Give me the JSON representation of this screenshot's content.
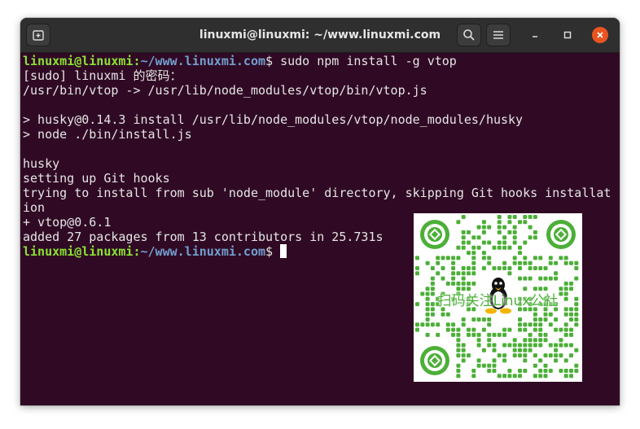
{
  "window": {
    "title": "linuxmi@linuxmi: ~/www.linuxmi.com",
    "new_tab_icon": "new-tab-icon",
    "search_icon": "search-icon",
    "menu_icon": "hamburger-menu-icon",
    "minimize_icon": "minimize-icon",
    "maximize_icon": "maximize-icon",
    "close_icon": "close-icon",
    "close_color": "#e95420"
  },
  "terminal": {
    "background": "#300a24",
    "prompt": {
      "user_host": "linuxmi@linuxmi",
      "separator": ":",
      "path": "~/www.linuxmi.com",
      "symbol": "$ "
    },
    "command": "sudo npm install -g vtop",
    "output": [
      "[sudo] linuxmi 的密码：",
      "/usr/bin/vtop -> /usr/lib/node_modules/vtop/bin/vtop.js",
      "",
      "> husky@0.14.3 install /usr/lib/node_modules/vtop/node_modules/husky",
      "> node ./bin/install.js",
      "",
      "husky",
      "setting up Git hooks",
      "trying to install from sub 'node_module' directory, skipping Git hooks installat",
      "ion",
      "+ vtop@0.6.1",
      "added 27 packages from 13 contributors in 25.731s"
    ]
  },
  "qr_overlay": {
    "caption": "扫码关注Linux公社",
    "color": "#4caf38",
    "icon": "penguin-icon"
  }
}
